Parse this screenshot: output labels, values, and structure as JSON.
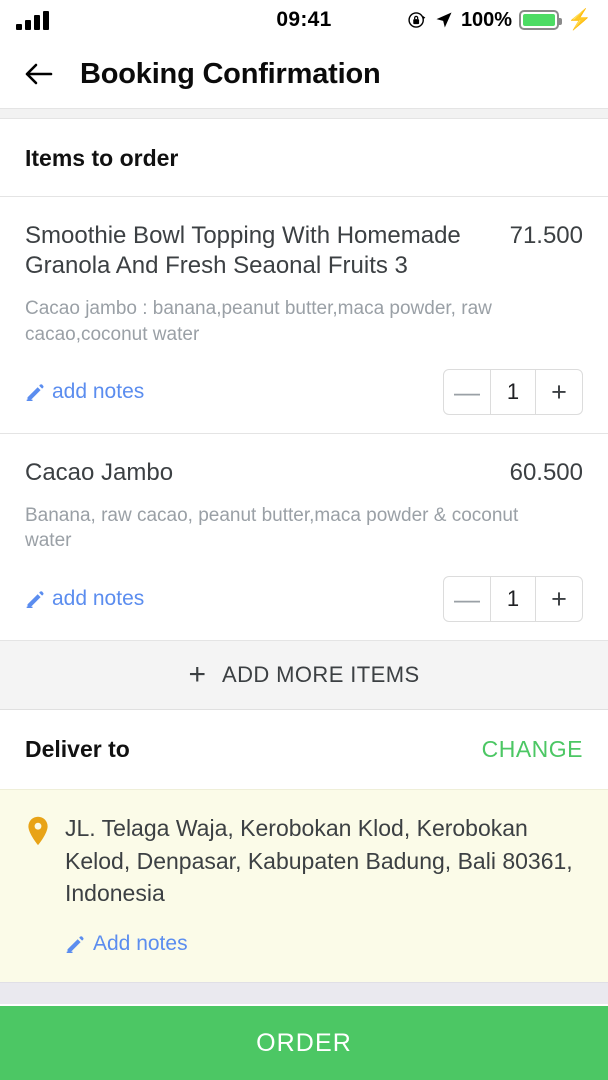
{
  "status_bar": {
    "time": "09:41",
    "battery_percent": "100%",
    "signal_icon": "signal-bars-icon",
    "rotation_lock_icon": "rotation-lock-icon",
    "location_icon": "location-arrow-icon",
    "battery_icon": "battery-full-icon",
    "charging_icon": "charging-bolt-icon"
  },
  "header": {
    "back_icon": "back-arrow-icon",
    "title": "Booking Confirmation"
  },
  "items_section": {
    "title": "Items to order",
    "items": [
      {
        "name": "Smoothie Bowl Topping With Homemade Granola And Fresh Seaonal Fruits 3",
        "price": "71.500",
        "description": "Cacao jambo : banana,peanut butter,maca powder, raw cacao,coconut water",
        "notes_label": "add notes",
        "notes_icon": "pencil-icon",
        "quantity": "1",
        "decrement_label": "—",
        "increment_label": "+"
      },
      {
        "name": "Cacao Jambo",
        "price": "60.500",
        "description": "Banana, raw cacao, peanut butter,maca powder & coconut water",
        "notes_label": "add notes",
        "notes_icon": "pencil-icon",
        "quantity": "1",
        "decrement_label": "—",
        "increment_label": "+"
      }
    ],
    "add_more_label": "ADD MORE ITEMS",
    "add_more_icon": "plus-icon"
  },
  "delivery": {
    "label": "Deliver to",
    "change_label": "CHANGE",
    "pin_icon": "map-pin-icon",
    "address": "JL. Telaga Waja, Kerobokan Klod, Kerobokan Kelod, Denpasar, Kabupaten Badung, Bali 80361, Indonesia",
    "notes_label": "Add notes",
    "notes_icon": "pencil-icon"
  },
  "footer": {
    "order_label": "ORDER"
  },
  "colors": {
    "accent_green": "#4cc764",
    "link_blue": "#5b8def",
    "pin_orange": "#e8a317",
    "address_bg": "#fbfbe8",
    "muted_text": "#9aa0a6"
  }
}
